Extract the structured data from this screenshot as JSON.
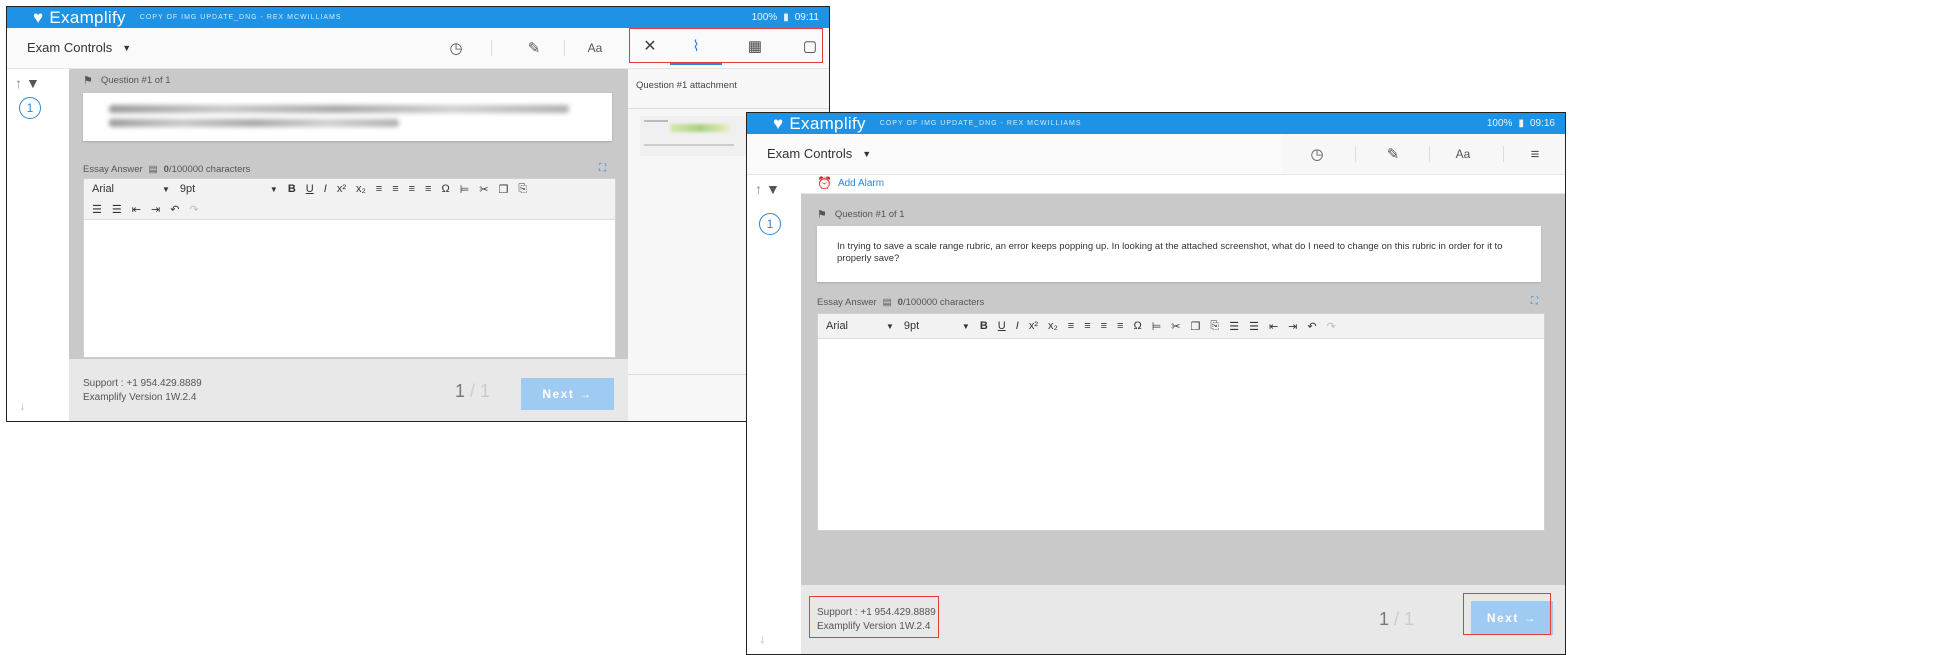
{
  "app": {
    "name": "Examplify",
    "subtitle": "COPY OF IMG UPDATE_DNG - REX MCWILLIAMS",
    "battery": "100%",
    "time_left": "09:11",
    "time_right": "09:16"
  },
  "toolbar": {
    "exam_controls": "Exam Controls",
    "font_tool": "Aa"
  },
  "panel": {
    "title": "Question #1 attachment"
  },
  "alarm": {
    "label": "Add Alarm"
  },
  "question": {
    "number": "1",
    "header": "Question #1 of 1",
    "text": "In trying to save a scale range rubric, an error keeps popping up. In looking at the attached screenshot, what do I need to change on this rubric in order for it to properly save?"
  },
  "essay": {
    "label": "Essay Answer",
    "count": "0",
    "limit": "/100000 characters"
  },
  "editor": {
    "font": "Arial",
    "size": "9pt"
  },
  "footer": {
    "support": "Support : +1 954.429.8889",
    "version": "Examplify Version 1W.2.4",
    "page_current": "1",
    "page_total": "/ 1",
    "next": "Next →"
  },
  "colors": {
    "brand": "#1e93e6",
    "highlight": "#e53b3b",
    "next_button": "#9fcaf1"
  }
}
